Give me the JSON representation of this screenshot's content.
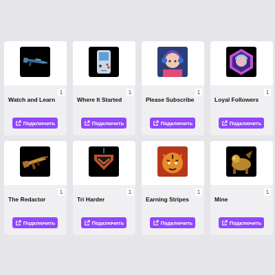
{
  "cards": [
    {
      "title": "Watch and Learn",
      "count": "1",
      "button": "Подключить",
      "icon": "rifle-icon"
    },
    {
      "title": "Where It Started",
      "count": "1",
      "button": "Подключить",
      "icon": "gameboy-icon"
    },
    {
      "title": "Please Subscribe",
      "count": "1",
      "button": "Подключить",
      "icon": "gamer-girl-icon"
    },
    {
      "title": "Loyal Followers",
      "count": "1",
      "button": "Подключить",
      "icon": "hexagon-portrait-icon"
    },
    {
      "title": "The Redactor",
      "count": "1",
      "button": "Подключить",
      "icon": "assault-rifle-icon"
    },
    {
      "title": "Tri Harder",
      "count": "1",
      "button": "Подключить",
      "icon": "chevron-charm-icon"
    },
    {
      "title": "Earning Stripes",
      "count": "1",
      "button": "Подключить",
      "icon": "tiger-icon"
    },
    {
      "title": "Mine",
      "count": "1",
      "button": "Подключить",
      "icon": "golden-creature-icon"
    }
  ],
  "colors": {
    "button": "#9146ff",
    "page_bg": "#e6e6ea",
    "card_bg": "#f0f0f3"
  }
}
